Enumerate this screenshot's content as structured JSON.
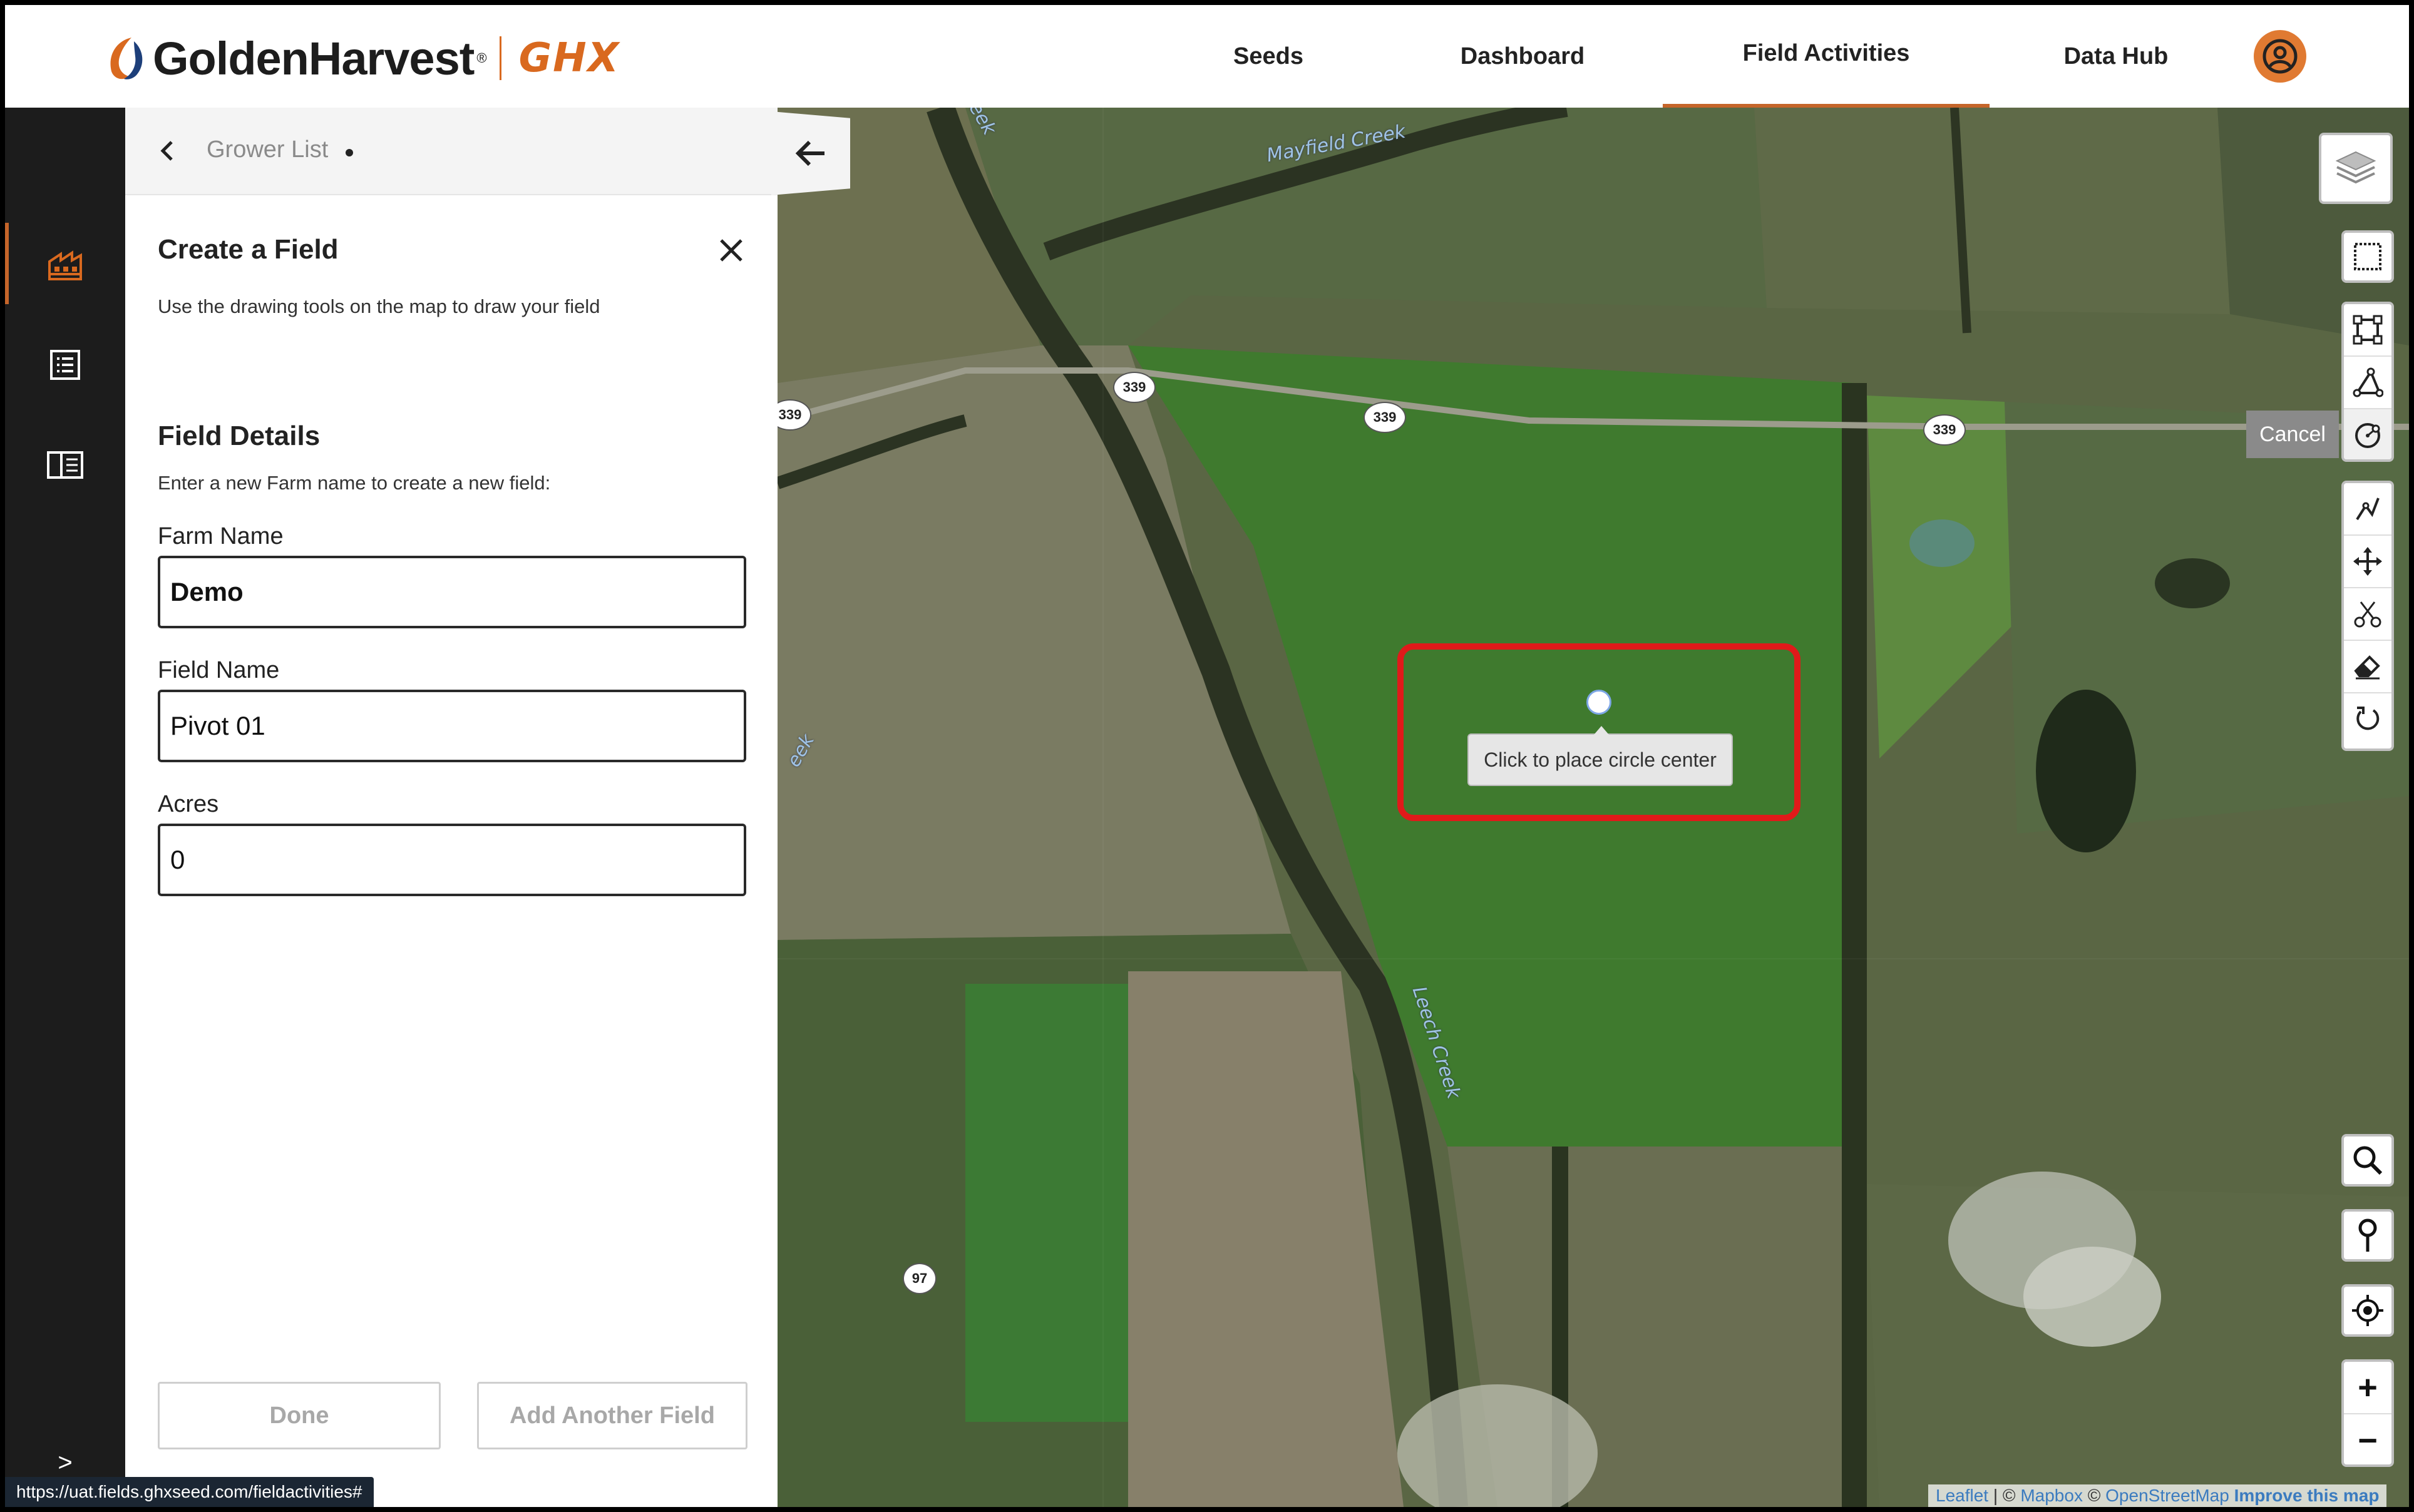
{
  "header": {
    "brand": "GoldenHarvest",
    "brand_mark": "®",
    "brand_secondary": "GHX",
    "nav": [
      {
        "label": "Seeds",
        "active": false
      },
      {
        "label": "Dashboard",
        "active": false
      },
      {
        "label": "Field Activities",
        "active": true
      },
      {
        "label": "Data Hub",
        "active": false
      }
    ],
    "avatar_icon": "user-circle-icon"
  },
  "rail": {
    "items": [
      {
        "icon": "farm-icon",
        "active": true
      },
      {
        "icon": "list-icon",
        "active": false
      },
      {
        "icon": "layout-icon",
        "active": false
      }
    ],
    "expand_label": ">"
  },
  "breadcrumb": {
    "label": "Grower List"
  },
  "panel": {
    "title": "Create a Field",
    "description": "Use the drawing tools on the map to draw your field",
    "details_title": "Field Details",
    "details_hint": "Enter a new Farm name to create a new field:",
    "farm_label": "Farm Name",
    "farm_value": "Demo",
    "field_label": "Field Name",
    "field_value": "Pivot 01",
    "acres_label": "Acres",
    "acres_value": "0",
    "done_label": "Done",
    "add_label": "Add Another Field"
  },
  "status_url": "https://uat.fields.ghxseed.com/fieldactivities#",
  "map": {
    "route_number": "339",
    "route_number_2": "97",
    "creek_1": "Mayfield Creek",
    "creek_2": "Leech Creek",
    "creek_fragment_1": "eek",
    "creek_fragment_2": "eek",
    "cancel_label": "Cancel",
    "tooltip": "Click to place circle center",
    "attribution": {
      "leaflet": "Leaflet",
      "sep": " | © ",
      "mapbox": "Mapbox",
      "sep2": " © ",
      "osm": "OpenStreetMap",
      "improve": "Improve this map"
    },
    "zoom_in": "+",
    "zoom_out": "−"
  },
  "colors": {
    "accent": "#c5652a",
    "brand_orange": "#d9691f",
    "highlight": "#e01a1a",
    "rail_bg": "#1c1c1c"
  }
}
